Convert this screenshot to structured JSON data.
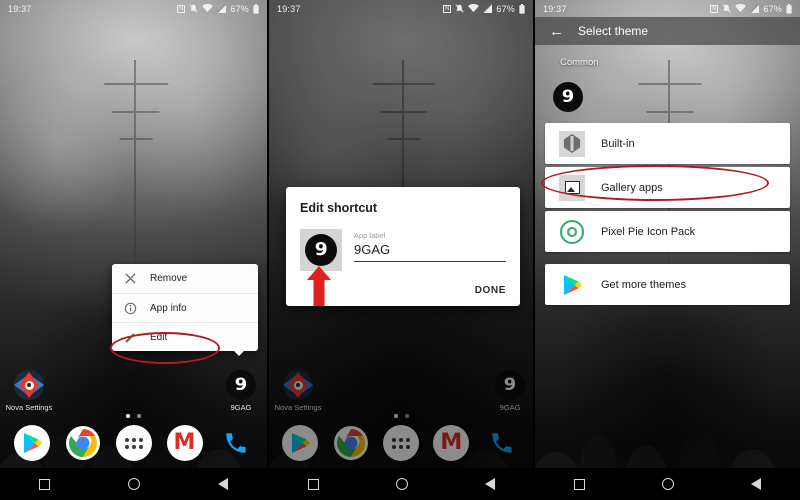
{
  "statusbar": {
    "time": "19:37",
    "battery_pct": "67%",
    "icons": [
      "nfc-icon",
      "notifications-muted-icon",
      "wifi-icon",
      "cell-signal-icon",
      "battery-icon"
    ]
  },
  "homescreen": {
    "apps": [
      {
        "label": "Nova Settings",
        "icon": "nova-settings-icon"
      },
      {
        "label": "9GAG",
        "icon": "ninegag-icon"
      }
    ],
    "page_dots": 2,
    "dock": [
      {
        "label": "Play Store",
        "icon": "play-store-icon"
      },
      {
        "label": "Chrome",
        "icon": "chrome-icon"
      },
      {
        "label": "App drawer",
        "icon": "app-drawer-icon"
      },
      {
        "label": "Gmail",
        "icon": "gmail-icon"
      },
      {
        "label": "Phone",
        "icon": "phone-icon"
      }
    ]
  },
  "navbar": {
    "recents": "square-icon",
    "home": "circle-icon",
    "back": "triangle-back-icon"
  },
  "panel1": {
    "menu": {
      "items": [
        {
          "label": "Remove",
          "icon": "close-x-icon"
        },
        {
          "label": "App info",
          "icon": "info-circle-icon"
        },
        {
          "label": "Edit",
          "icon": "pencil-icon"
        }
      ],
      "highlighted": "Edit"
    }
  },
  "panel2": {
    "dialog": {
      "title": "Edit shortcut",
      "icon": "ninegag-icon",
      "field_label": "App label",
      "field_value": "9GAG",
      "field_placeholder": "App label",
      "done_label": "DONE",
      "annotation": "red-up-arrow pointing at app icon"
    }
  },
  "panel3": {
    "appbar": {
      "back": "←",
      "title": "Select theme"
    },
    "section_header": "Common",
    "preview_icon": "ninegag-icon",
    "themes": [
      {
        "label": "Built-in",
        "icon": "builtin-icon",
        "highlighted": false
      },
      {
        "label": "Gallery apps",
        "icon": "gallery-picture-icon",
        "highlighted": true
      },
      {
        "label": "Pixel Pie Icon Pack",
        "icon": "pixel-pie-icon",
        "highlighted": false
      },
      {
        "label": "Get more themes",
        "icon": "play-store-icon",
        "highlighted": false
      }
    ]
  },
  "colors": {
    "annotation_red": "#b11a22",
    "arrow_red": "#e02020",
    "accent_green": "#2fae6a",
    "gmail_red": "#d93025",
    "phone_blue": "#1ea0f0"
  }
}
